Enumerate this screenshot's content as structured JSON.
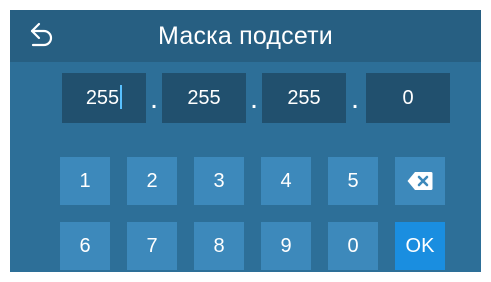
{
  "header": {
    "title": "Маска подсети",
    "back_icon": "back-arrow-icon"
  },
  "ip": {
    "octets": [
      "255",
      "255",
      "255",
      "0"
    ],
    "separator": ".",
    "focused_octet": 1
  },
  "keypad": {
    "row1": [
      "1",
      "2",
      "3",
      "4",
      "5"
    ],
    "row2": [
      "6",
      "7",
      "8",
      "9",
      "0"
    ],
    "backspace_icon": "backspace-icon",
    "ok_label": "OK"
  },
  "colors": {
    "background": "#2d6f98",
    "header": "#275f82",
    "field": "#21506e",
    "key": "#3d89bb",
    "ok_key": "#1a8ee0",
    "caret": "#59c1ff"
  }
}
